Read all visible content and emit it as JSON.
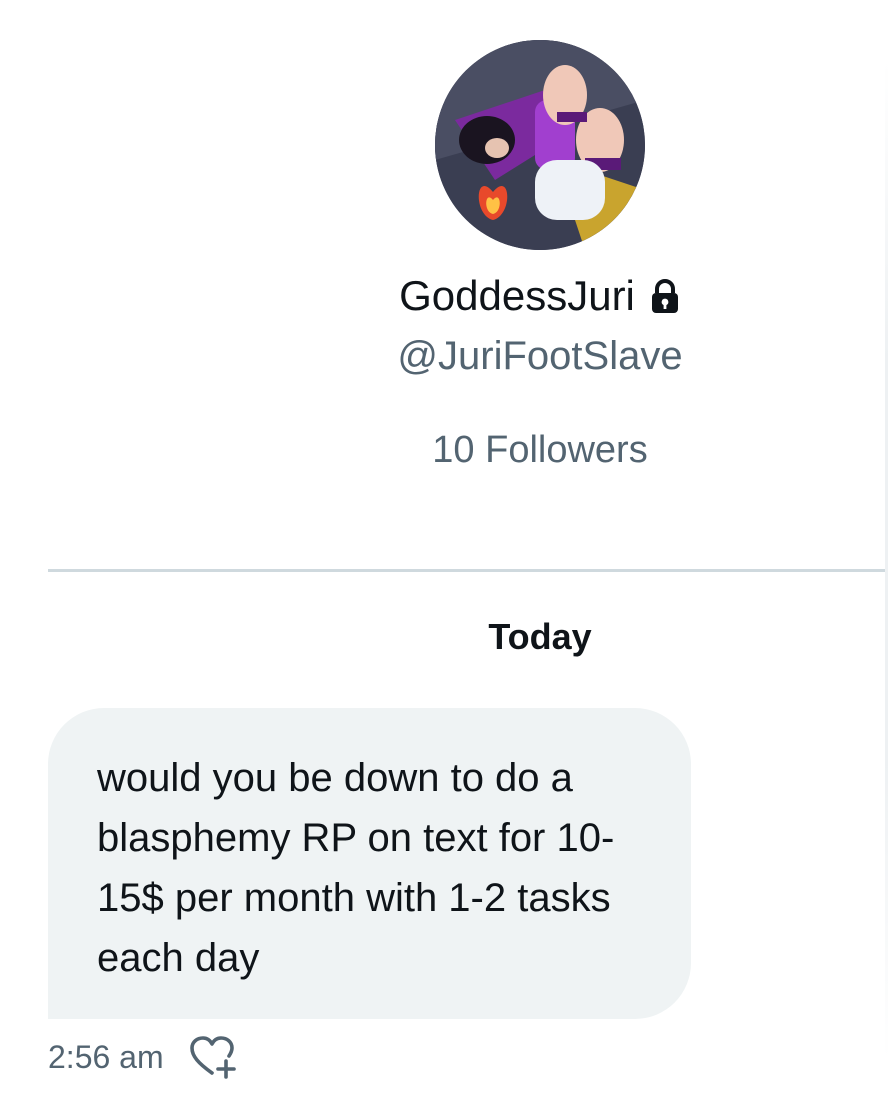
{
  "profile": {
    "display_name": "GoddessJuri",
    "handle": "@JuriFootSlave",
    "followers": "10 Followers",
    "avatar_icon": "profile-avatar",
    "lock_icon": "lock-icon"
  },
  "conversation": {
    "day_label": "Today",
    "messages": [
      {
        "text": "would you be down to do a blasphemy RP on text for 10-15$ per month with 1-2 tasks each day",
        "time": "2:56 am",
        "reaction_icon": "add-reaction-heart-icon"
      }
    ]
  },
  "colors": {
    "text_primary": "#0f1419",
    "text_secondary": "#536471",
    "bubble_bg": "#eff3f4",
    "divider": "#cfd9de"
  }
}
